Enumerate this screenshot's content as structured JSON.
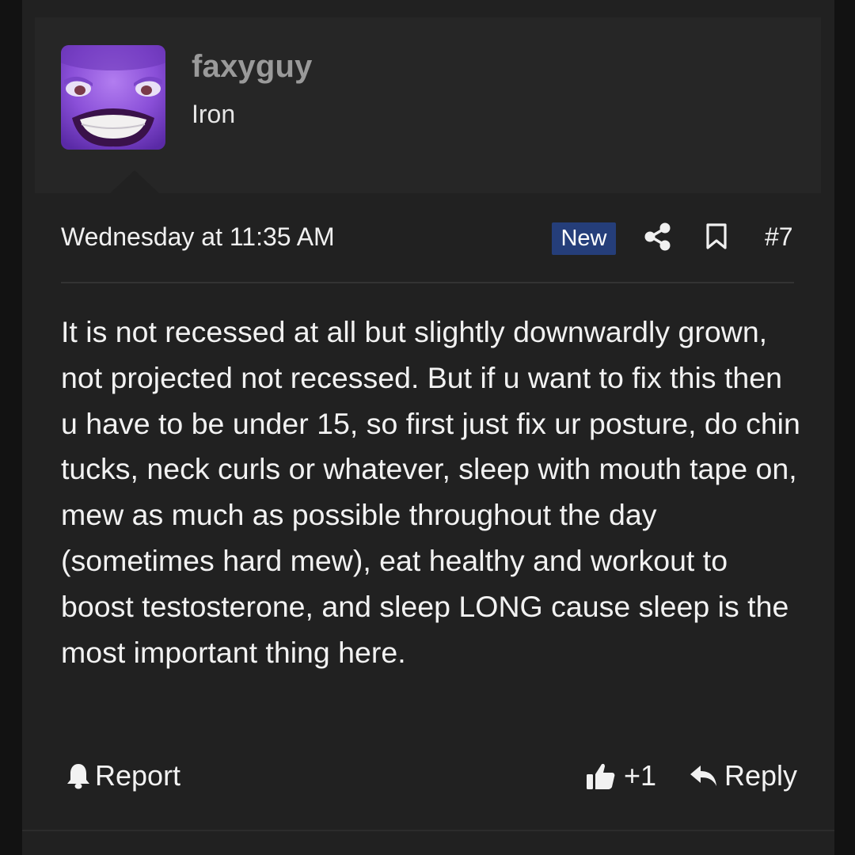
{
  "user": {
    "username": "faxyguy",
    "title": "Iron",
    "avatar_icon": "purple-smiling-character-avatar"
  },
  "post": {
    "date": "Wednesday at 11:35 AM",
    "badge": "New",
    "number": "#7",
    "body": "It is not recessed at all but slightly downwardly grown, not projected not recessed. But if u want to fix this then u have to be under 15, so first just fix ur posture, do chin tucks, neck curls or whatever, sleep with mouth tape on, mew as much as possible throughout the day (sometimes hard mew), eat healthy and workout to boost testosterone, and sleep LONG cause sleep is the most important thing here."
  },
  "actions": {
    "report_label": "Report",
    "like_count": "+1",
    "reply_label": "Reply"
  },
  "icons": {
    "share": "share-icon",
    "bookmark": "bookmark-icon",
    "report": "bell-alert-icon",
    "like": "thumbs-up-icon",
    "reply": "reply-arrow-icon"
  },
  "colors": {
    "background": "#212121",
    "user_block": "#262626",
    "new_badge": "#253e7a",
    "username": "#9a9a9a",
    "text": "#f2f2f2"
  }
}
